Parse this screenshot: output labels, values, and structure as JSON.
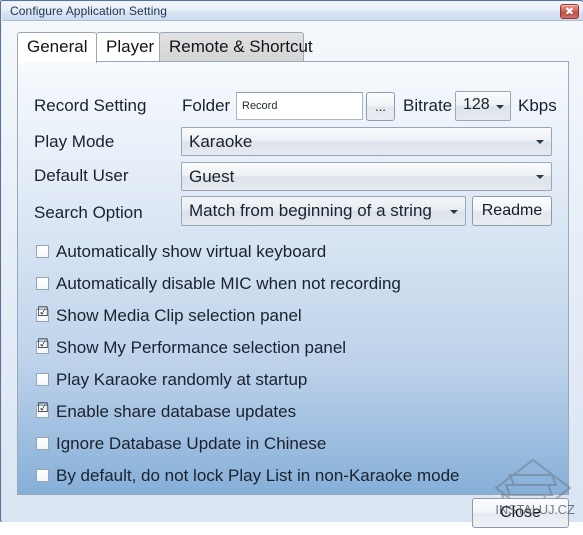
{
  "window": {
    "title": "Configure Application Setting",
    "close_glyph": "✖",
    "close_icon_name": "close-icon"
  },
  "tabs": [
    {
      "label": "General",
      "state": "selected"
    },
    {
      "label": "Player",
      "state": "normal"
    },
    {
      "label": "Remote & Shortcut",
      "state": "hot"
    }
  ],
  "general": {
    "record_setting": {
      "label": "Record Setting",
      "folder_label": "Folder",
      "folder_value": "Record",
      "folder_placeholder": "Record",
      "browse_label": "...",
      "bitrate_label": "Bitrate",
      "bitrate_value": "128",
      "bitrate_unit": "Kbps"
    },
    "play_mode": {
      "label": "Play Mode",
      "value": "Karaoke"
    },
    "default_user": {
      "label": "Default User",
      "value": "Guest"
    },
    "search_option": {
      "label": "Search Option",
      "value": "Match from beginning of a string",
      "readme_label": "Readme"
    },
    "checkboxes": [
      {
        "label": "Automatically show virtual keyboard",
        "checked": false,
        "glyph": ""
      },
      {
        "label": "Automatically disable MIC when not recording",
        "checked": false,
        "glyph": ""
      },
      {
        "label": "Show Media Clip selection panel",
        "checked": true,
        "glyph": "☑"
      },
      {
        "label": "Show My Performance selection panel",
        "checked": true,
        "glyph": "☑"
      },
      {
        "label": "Play Karaoke randomly at startup",
        "checked": false,
        "glyph": ""
      },
      {
        "label": "Enable share database updates",
        "checked": true,
        "glyph": "☑"
      },
      {
        "label": "Ignore Database Update in Chinese",
        "checked": false,
        "glyph": ""
      },
      {
        "label": "By default, do not lock Play List in non-Karaoke mode",
        "checked": false,
        "glyph": ""
      }
    ]
  },
  "footer": {
    "close_label": "Close"
  },
  "watermark": {
    "text": "INSTALUJ.CZ"
  },
  "colors": {
    "titlebar_text": "#1e3350",
    "close_button": "#c24c41",
    "panel_top": "#f7fafd",
    "panel_bottom": "#86afd8",
    "label_text": "#19222e"
  }
}
